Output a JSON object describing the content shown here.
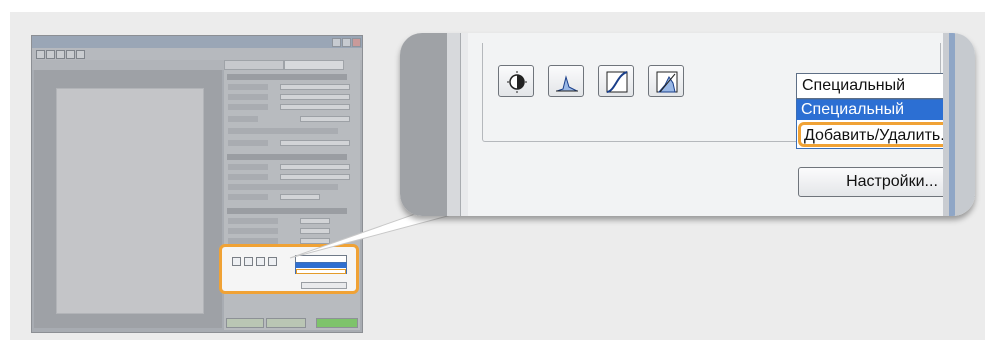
{
  "callout": {
    "mode_select": {
      "value": "Специальный",
      "options": [
        "Специальный",
        "Добавить/Удалить..."
      ]
    },
    "settings_button": "Настройки...",
    "tool_icons": [
      "brightness-contrast-icon",
      "histogram-icon",
      "tone-curve-icon",
      "final-review-icon"
    ]
  },
  "colors": {
    "highlight": "#f0a235",
    "selection": "#2c6fd3"
  }
}
